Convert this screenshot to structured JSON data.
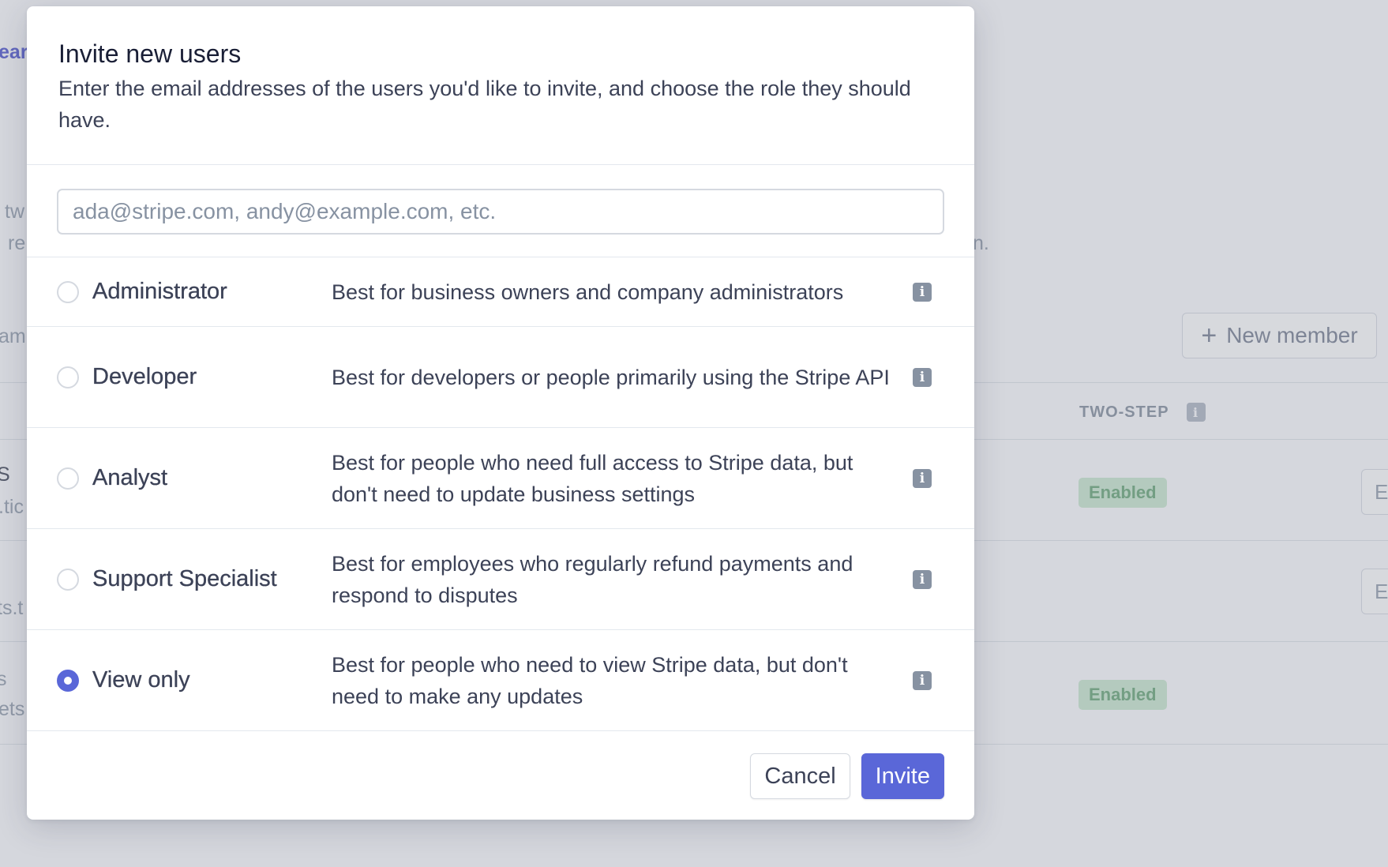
{
  "background": {
    "fragments": [
      "ear",
      "tw",
      "re",
      "n.",
      "am",
      "S",
      ".tic",
      "ts.t",
      "s",
      "ets"
    ],
    "new_member_label": "New member",
    "two_step_header": "TWO-STEP",
    "badges": [
      "Enabled",
      "Enabled"
    ],
    "side_buttons": [
      "E",
      "E"
    ]
  },
  "modal": {
    "title": "Invite new users",
    "description": "Enter the email addresses of the users you'd like to invite, and choose the role they should have.",
    "email_input": {
      "value": "",
      "placeholder": "ada@stripe.com, andy@example.com, etc."
    },
    "roles": [
      {
        "name": "Administrator",
        "description": "Best for business owners and company administrators",
        "selected": false
      },
      {
        "name": "Developer",
        "description": "Best for developers or people primarily using the Stripe API",
        "selected": false
      },
      {
        "name": "Analyst",
        "description": "Best for people who need full access to Stripe data, but don't need to update business settings",
        "selected": false
      },
      {
        "name": "Support Specialist",
        "description": "Best for employees who regularly refund payments and respond to disputes",
        "selected": false
      },
      {
        "name": "View only",
        "description": "Best for people who need to view Stripe data, but don't need to make any updates",
        "selected": true
      }
    ],
    "info_glyph": "i",
    "cancel_label": "Cancel",
    "invite_label": "Invite"
  },
  "colors": {
    "accent": "#5a67d8",
    "title_text": "#1a1f36",
    "body_text": "#3c4257",
    "border": "#e3e8ee",
    "enabled_badge_bg": "#cfe8d5"
  }
}
